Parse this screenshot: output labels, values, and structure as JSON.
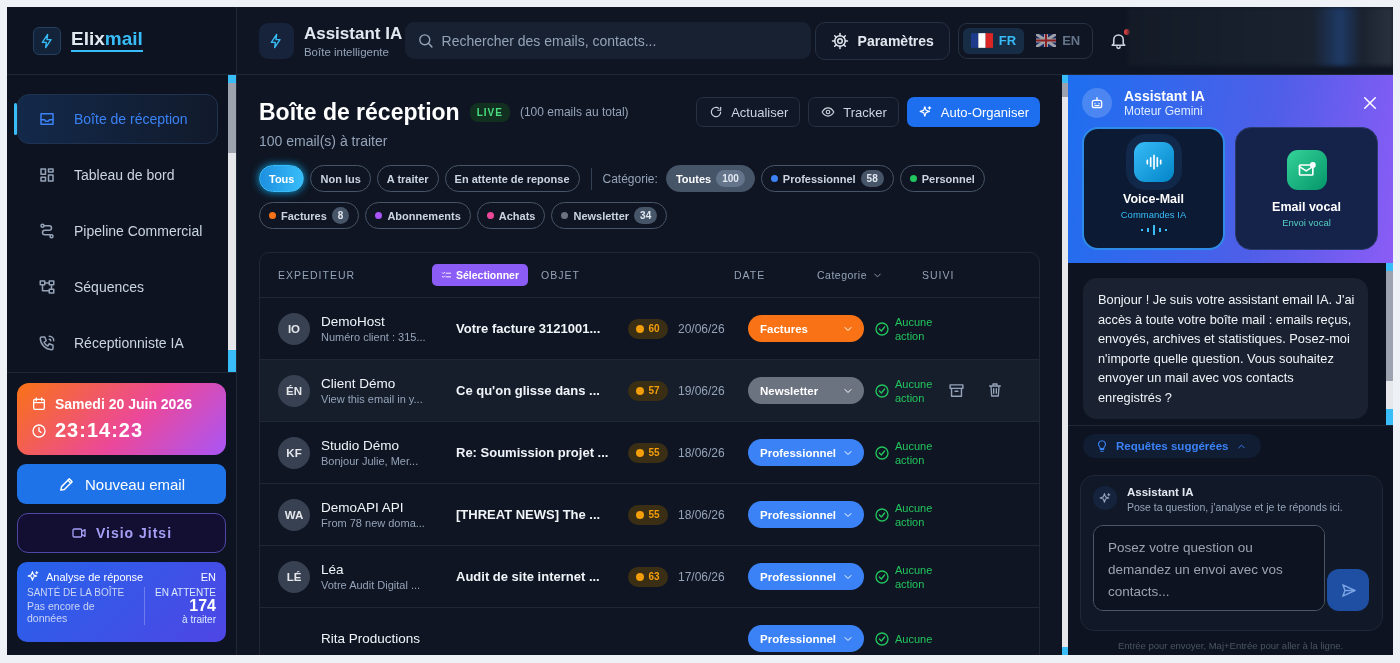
{
  "app": {
    "logo_prefix": "Elix",
    "logo_suffix": "mail"
  },
  "sidebar": {
    "nav": [
      {
        "label": "Boîte de réception",
        "selected": true
      },
      {
        "label": "Tableau de bord",
        "selected": false
      },
      {
        "label": "Pipeline Commercial",
        "selected": false
      },
      {
        "label": "Séquences",
        "selected": false
      },
      {
        "label": "Réceptionniste IA",
        "selected": false
      }
    ],
    "date_card": {
      "date": "Samedi 20 Juin 2026",
      "time": "23:14:23"
    },
    "new_email_button": "Nouveau email",
    "visio_button": "Visio Jitsi",
    "analysis_card": {
      "title": "Analyse de réponse",
      "lang": "EN",
      "health_label": "SANTÉ DE LA BOÎTE",
      "health_value": "Pas encore de données",
      "pending_label": "EN ATTENTE",
      "pending_count": "174",
      "pending_note": "à traiter"
    }
  },
  "topbar": {
    "title": "Assistant IA",
    "subtitle": "Boîte intelligente",
    "search": {
      "placeholder": "Rechercher des emails, contacts..."
    },
    "settings_button": "Paramètres",
    "languages": [
      {
        "code": "FR",
        "selected": true
      },
      {
        "code": "EN",
        "selected": false
      }
    ],
    "notifications": {
      "unread": true
    }
  },
  "inbox": {
    "title": "Boîte de réception",
    "live_badge": "LIVE",
    "total": "(100 emails au total)",
    "subtitle": "100 email(s) à traiter",
    "actions": [
      {
        "label": "Actualiser",
        "kind": "outline"
      },
      {
        "label": "Tracker",
        "kind": "outline"
      },
      {
        "label": "Auto-Organiser",
        "kind": "primary"
      }
    ],
    "filters": [
      {
        "label": "Tous",
        "selected": true
      },
      {
        "label": "Non lus",
        "selected": false
      },
      {
        "label": "A traiter",
        "selected": false
      },
      {
        "label": "En attente de reponse",
        "selected": false
      }
    ],
    "category_label": "Catégorie:",
    "categories": [
      {
        "label": "Toutes",
        "count": "100",
        "selected": true
      },
      {
        "label": "Professionnel",
        "color": "#3b82f6",
        "count": "58",
        "selected": false
      },
      {
        "label": "Personnel",
        "color": "#22c55e",
        "selected": false
      },
      {
        "label": "Factures",
        "color": "#f97316",
        "count": "8",
        "selected": false
      },
      {
        "label": "Abonnements",
        "color": "#a855f7",
        "selected": false
      },
      {
        "label": "Achats",
        "color": "#ec4899",
        "selected": false
      },
      {
        "label": "Newsletter",
        "color": "#6b7280",
        "count": "34",
        "selected": false
      }
    ],
    "table": {
      "columns": [
        {
          "label": "EXPEDITEUR",
          "dropdown": false
        },
        {
          "label": "OBJET",
          "dropdown": false
        },
        {
          "label": "DATE",
          "dropdown": false
        },
        {
          "label": "Categorie",
          "dropdown": true
        },
        {
          "label": "SUIVI",
          "dropdown": false
        }
      ],
      "select_button": "Sélectionner",
      "rows": [
        {
          "initials": "IO",
          "sender": "DemoHost",
          "preview": "Numéro client : 315...",
          "subject": "Votre facture 3121001...",
          "score": "60",
          "date": "20/06/26",
          "category": "Factures",
          "color": "#f97316",
          "status": "Aucune action",
          "hovered": false
        },
        {
          "initials": "ÉN",
          "sender": "Client Démo",
          "preview": "View this email in y...",
          "subject": "Ce qu'on glisse dans ...",
          "score": "57",
          "date": "19/06/26",
          "category": "Newsletter",
          "color": "#6b7280",
          "status": "Aucune action",
          "hovered": true
        },
        {
          "initials": "KF",
          "sender": "Studio Démo",
          "preview": "Bonjour Julie, Mer...",
          "subject": "Re: Soumission projet ...",
          "score": "55",
          "date": "18/06/26",
          "category": "Professionnel",
          "color": "#3b82f6",
          "status": "Aucune action",
          "hovered": false
        },
        {
          "initials": "WA",
          "sender": "DemoAPI API",
          "preview": "From 78 new doma...",
          "subject": "[THREAT NEWS] The ...",
          "score": "55",
          "date": "18/06/26",
          "category": "Professionnel",
          "color": "#3b82f6",
          "status": "Aucune action",
          "hovered": false
        },
        {
          "initials": "LÉ",
          "sender": "Léa",
          "preview": "Votre Audit Digital ...",
          "subject": "Audit de site internet ...",
          "score": "63",
          "date": "17/06/26",
          "category": "Professionnel",
          "color": "#3b82f6",
          "status": "Aucune action",
          "hovered": false
        },
        {
          "sender": "Rita Productions",
          "category": "Professionnel",
          "color": "#3b82f6",
          "status": "Aucune",
          "hovered": false
        }
      ]
    }
  },
  "assistant": {
    "title": "Assistant IA",
    "subtitle": "Moteur Gemini",
    "modes": [
      {
        "title": "Voice-Mail",
        "subtitle": "Commandes IA",
        "active": true
      },
      {
        "title": "Email vocal",
        "subtitle": "Envoi vocal",
        "active": false
      }
    ],
    "message": "Bonjour ! Je suis votre assistant email IA. J'ai accès à toute votre boîte mail : emails reçus, envoyés, archives et statistiques. Posez-moi n'importe quelle question. Vous souhaitez envoyer un mail avec vos contacts enregistrés ?",
    "suggestions_toggle": {
      "label": "Requêtes suggérées",
      "expanded": false
    },
    "composer": {
      "title": "Assistant IA",
      "subtitle": "Pose ta question, j'analyse et je te réponds ici.",
      "placeholder": "Posez votre question ou demandez un envoi avec vos contacts...",
      "hint": "Entrée pour envoyer, Maj+Entrée pour aller à la ligne."
    }
  }
}
